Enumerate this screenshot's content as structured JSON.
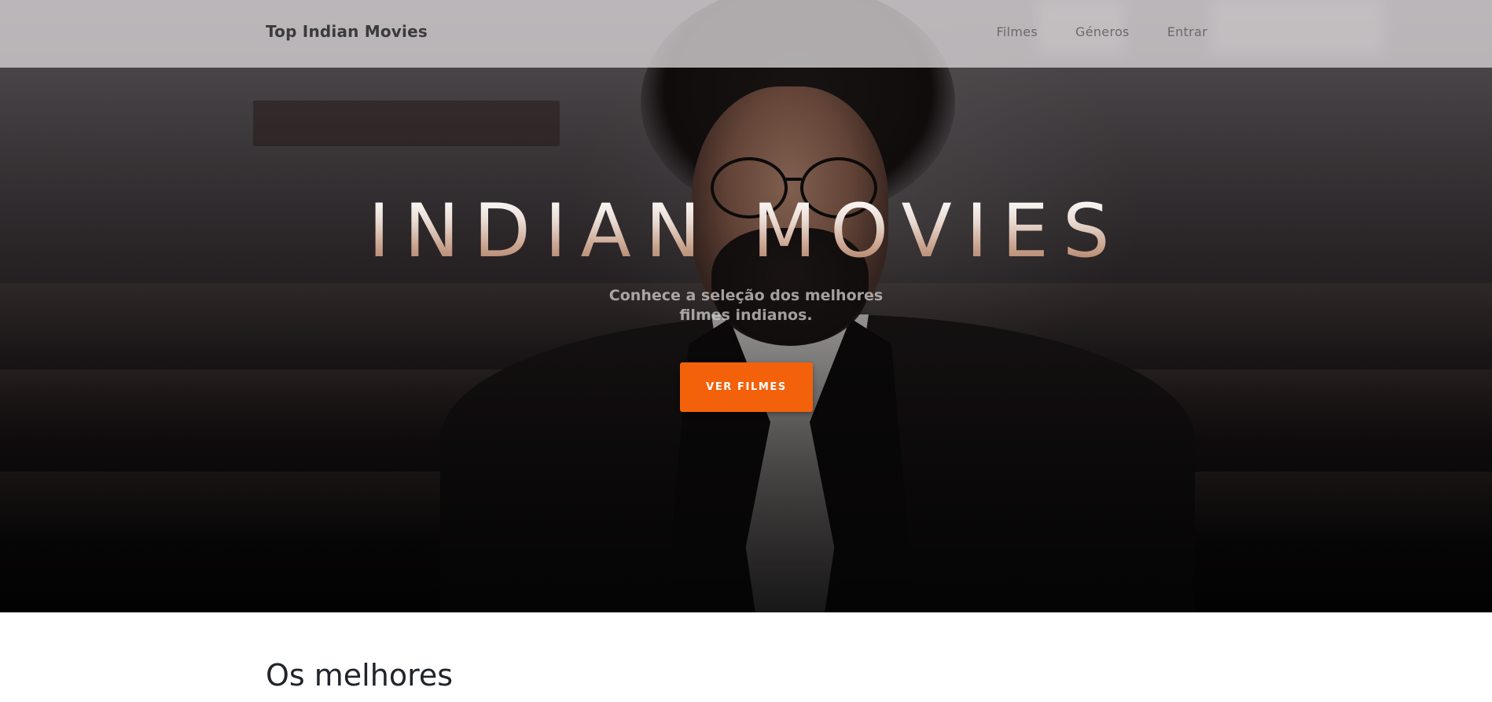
{
  "navbar": {
    "brand": "Top Indian Movies",
    "links": [
      {
        "label": "Filmes"
      },
      {
        "label": "Géneros"
      },
      {
        "label": "Entrar"
      }
    ]
  },
  "hero": {
    "title": "INDIAN MOVIES",
    "subtitle": "Conhece a seleção dos melhores filmes indianos.",
    "cta_label": "VER FILMES"
  },
  "section": {
    "heading": "Os melhores"
  },
  "colors": {
    "accent": "#f4610b",
    "navbar_bg": "#d2cdcf",
    "heading_text": "#212529"
  }
}
